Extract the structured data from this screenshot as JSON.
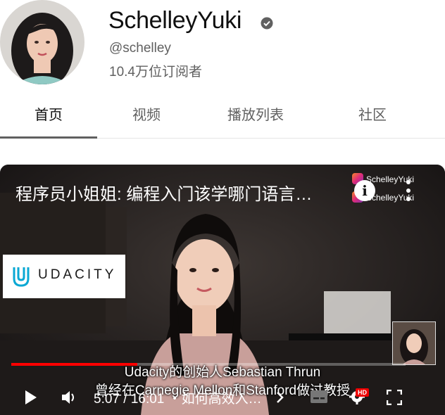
{
  "channel": {
    "name": "SchelleyYuki",
    "verified": true,
    "handle": "@schelley",
    "subscribers": "10.4万位订阅者"
  },
  "tabs": [
    {
      "label": "首页",
      "active": true
    },
    {
      "label": "视频",
      "active": false
    },
    {
      "label": "播放列表",
      "active": false
    },
    {
      "label": "社区",
      "active": false
    }
  ],
  "player": {
    "title": "程序员小姐姐: 编程入门该学哪门语言…",
    "watermark": [
      "SchelleyYuki",
      "SchelleyYuki"
    ],
    "sponsor_logo": "UDACITY",
    "captions": [
      "Udacity的创始人Sebastian Thrun",
      "曾经在Carnegie Mellon和Stanford做过教授"
    ],
    "time_display": "5:07 / 16:01",
    "chapter": "・如何高效入…",
    "progress": 0.32,
    "quality_badge": "HD",
    "colors": {
      "progress": "#ff0000",
      "hd_badge": "#ee0000"
    }
  },
  "icons": [
    "verified-check-icon",
    "info-icon",
    "more-vert-icon",
    "play-icon",
    "volume-icon",
    "chevron-right-icon",
    "subtitles-icon",
    "settings-gear-icon",
    "fullscreen-icon"
  ]
}
